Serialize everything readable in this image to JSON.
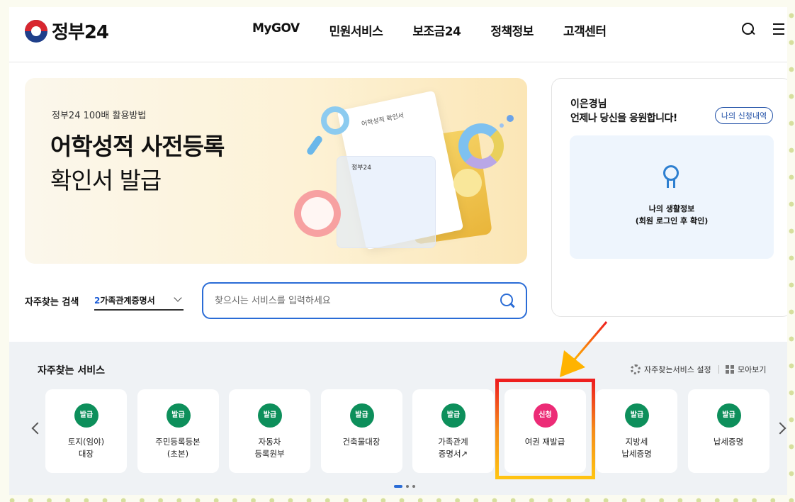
{
  "header": {
    "logo_text": "정부24",
    "nav": [
      "MyGOV",
      "민원서비스",
      "보조금24",
      "정책정보",
      "고객센터"
    ]
  },
  "banner": {
    "subtitle": "정부24 100배 활용방법",
    "title_line1": "어학성적 사전등록",
    "title_line2": "확인서 발급",
    "paper_title": "어학성적 확인서",
    "glass_logo": "정부24"
  },
  "search": {
    "label": "자주찾는 검색",
    "rank": "2",
    "keyword": "가족관계증명서",
    "placeholder": "찾으시는 서비스를 입력하세요"
  },
  "user_panel": {
    "name": "이은경님",
    "greeting": "언제나 당신을 응원합니다!",
    "my_apply_button": "나의 신청내역",
    "life_info_title": "나의 생활정보",
    "life_info_sub": "(회원 로그인 후 확인)"
  },
  "services": {
    "title": "자주찾는 서비스",
    "settings_label": "자주찾는서비스 설정",
    "view_all_label": "모아보기",
    "items": [
      {
        "badge": "발급",
        "label": "토지(임야)\n대장",
        "color": "green"
      },
      {
        "badge": "발급",
        "label": "주민등록등본\n(초본)",
        "color": "green"
      },
      {
        "badge": "발급",
        "label": "자동차\n등록원부",
        "color": "green"
      },
      {
        "badge": "발급",
        "label": "건축물대장",
        "color": "green"
      },
      {
        "badge": "발급",
        "label": "가족관계\n증명서↗",
        "color": "green"
      },
      {
        "badge": "신청",
        "label": "여권 재발급",
        "color": "pink"
      },
      {
        "badge": "발급",
        "label": "지방세\n납세증명",
        "color": "green"
      },
      {
        "badge": "발급",
        "label": "납세증명",
        "color": "green"
      }
    ]
  },
  "colors": {
    "accent_blue": "#2a6cd6",
    "issue_green": "#0d8f5b",
    "apply_pink": "#ec2b76",
    "highlight_red": "#ee1f1f",
    "highlight_yellow": "#ffc312",
    "arrow_orange": "#f58a1a"
  }
}
